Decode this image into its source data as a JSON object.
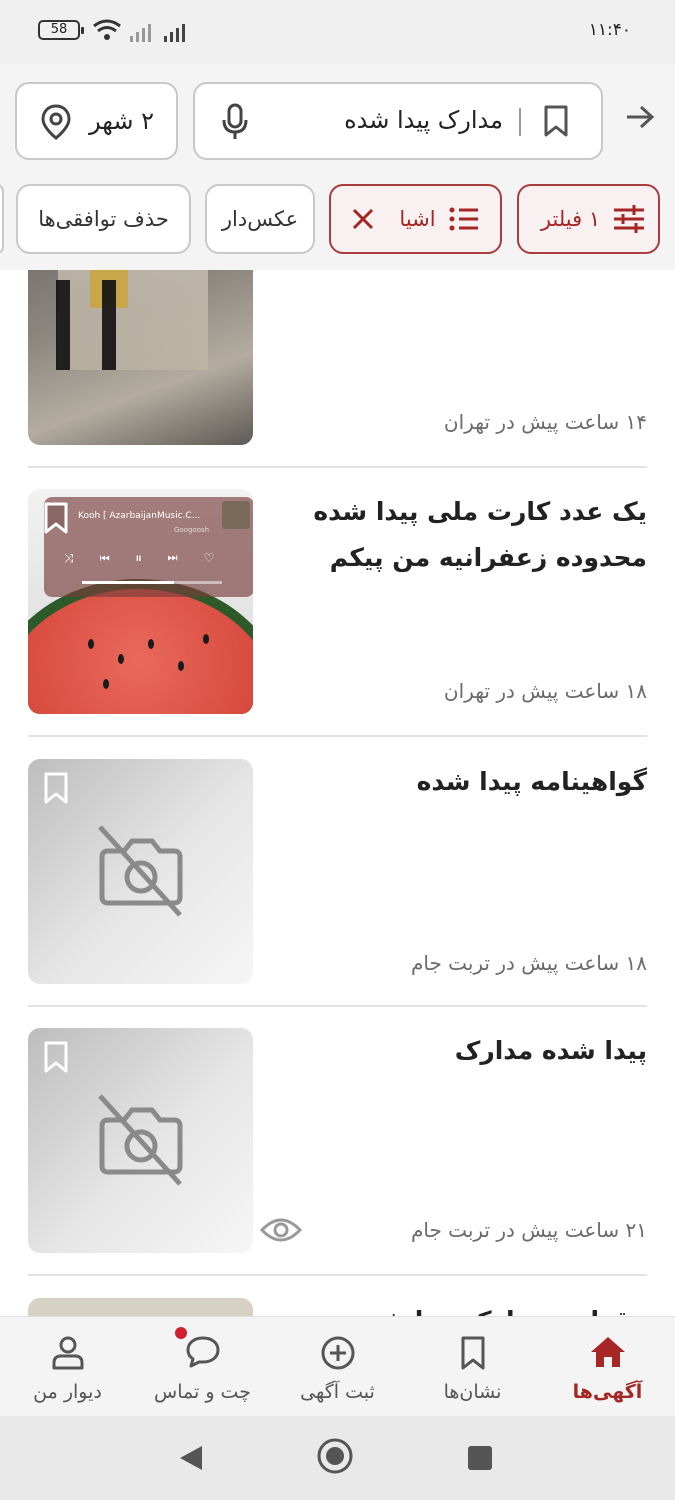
{
  "status_bar": {
    "battery": "58",
    "time": "۱۱:۴۰"
  },
  "header": {
    "city_label": "۲ شهر",
    "search_query": "مدارک پیدا شده",
    "icons": {
      "location": "location-pin-icon",
      "mic": "microphone-icon",
      "bookmark": "bookmark-icon",
      "back": "arrow-right-icon"
    }
  },
  "filters": {
    "filter_chip": "۱ فیلتر",
    "category_chip": "اشیا",
    "photo_chip": "عکس‌دار",
    "remove_chip": "حذف توافقی‌ها"
  },
  "listings": [
    {
      "title": "",
      "meta": "۱۴ ساعت پیش در تهران",
      "image": "photo"
    },
    {
      "title": "یک عدد کارت ملی پیدا شده محدوده زعفرانیه من پیکم",
      "meta": "۱۸ ساعت پیش در تهران",
      "image": "photo",
      "overlay": {
        "track": "Kooh [ AzarbaijanMusic.C...",
        "artist": "Googoosh"
      }
    },
    {
      "title": "گواهینامه پیدا شده",
      "meta": "۱۸ ساعت پیش در تربت جام",
      "image": "none"
    },
    {
      "title": "پیدا شده مدارک",
      "meta": "۲۱ ساعت پیش در تربت جام",
      "image": "none",
      "seen": true
    },
    {
      "title": "مقداری مدارک پیدا شده",
      "meta": "",
      "image": "photo"
    }
  ],
  "bottom_nav": [
    {
      "label": "آگهی‌ها",
      "icon": "home-icon",
      "active": true
    },
    {
      "label": "نشان‌ها",
      "icon": "bookmark-icon",
      "active": false
    },
    {
      "label": "ثبت آگهی",
      "icon": "add-circle-icon",
      "active": false
    },
    {
      "label": "چت و تماس",
      "icon": "chat-icon",
      "active": false,
      "notification": true
    },
    {
      "label": "دیوار من",
      "icon": "user-icon",
      "active": false
    }
  ],
  "colors": {
    "accent": "#a62626",
    "chip_border": "#c8c8c8",
    "notification": "#d01f2f"
  }
}
